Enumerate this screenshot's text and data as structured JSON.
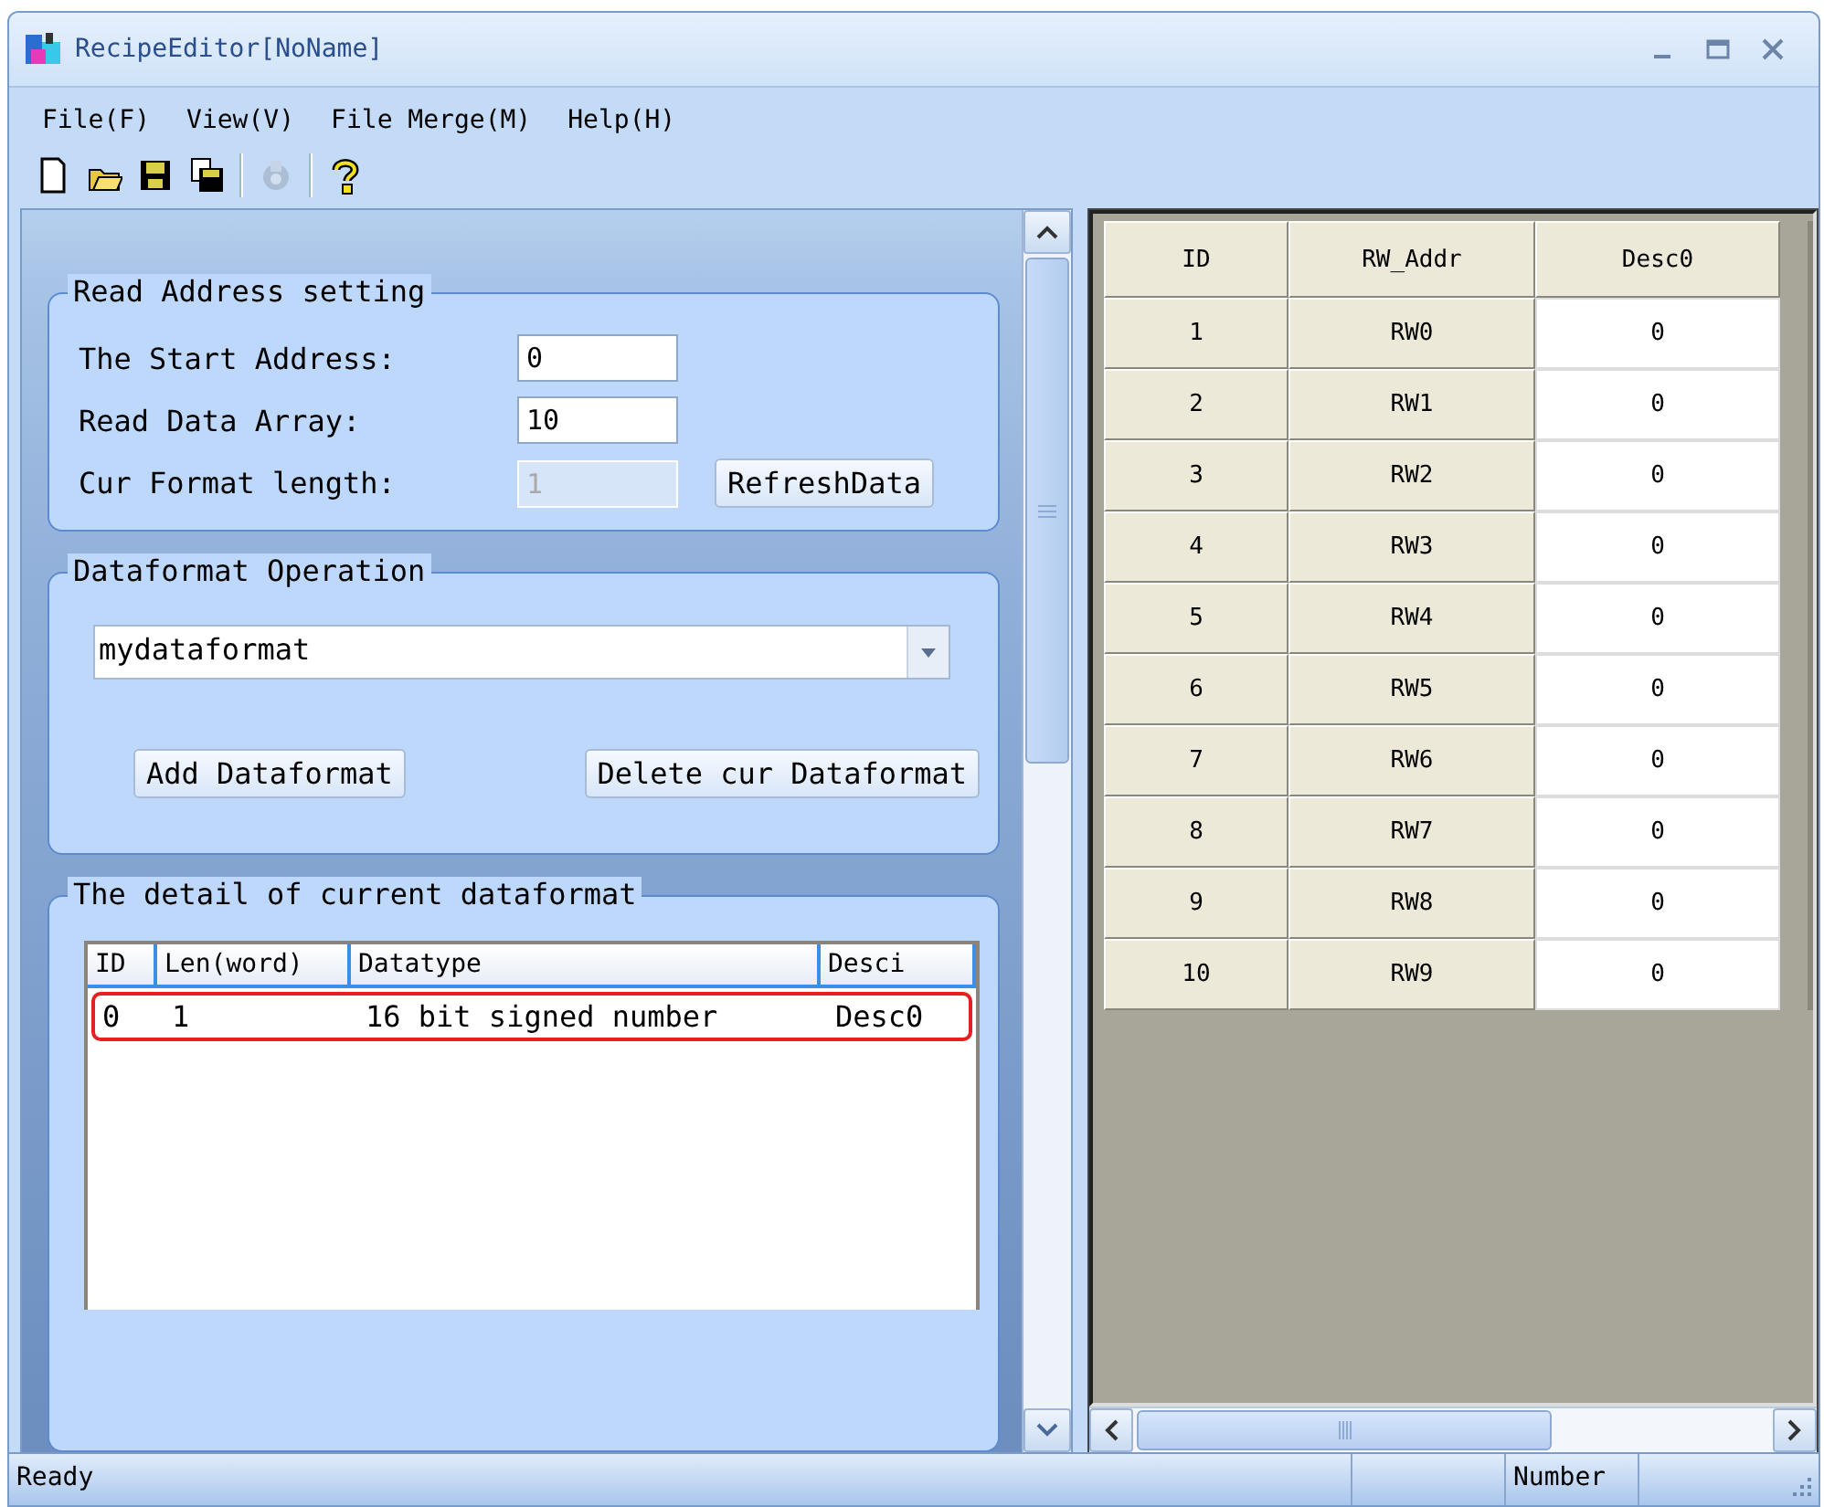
{
  "window": {
    "title": "RecipeEditor[NoName]"
  },
  "menu": [
    {
      "label": "File(F)"
    },
    {
      "label": "View(V)"
    },
    {
      "label": "File Merge(M)"
    },
    {
      "label": "Help(H)"
    }
  ],
  "toolbar": [
    {
      "kind": "new",
      "disabled": false
    },
    {
      "kind": "open",
      "disabled": false
    },
    {
      "kind": "save",
      "disabled": false
    },
    {
      "kind": "saveas",
      "disabled": false
    },
    {
      "kind": "sep"
    },
    {
      "kind": "print",
      "disabled": true
    },
    {
      "kind": "sep"
    },
    {
      "kind": "help",
      "disabled": false
    }
  ],
  "read_address": {
    "title": "Read Address setting",
    "fields": [
      {
        "label": "The Start Address:",
        "value": "0",
        "disabled": false
      },
      {
        "label": "Read Data Array:",
        "value": "10",
        "disabled": false
      },
      {
        "label": "Cur Format length:",
        "value": "1",
        "disabled": true
      }
    ],
    "button": "RefreshData"
  },
  "dataformat": {
    "title": "Dataformat Operation",
    "combo": "mydataformat",
    "buttons": [
      "Add Dataformat",
      "Delete cur Dataformat"
    ]
  },
  "detail": {
    "title": "The detail of current dataformat",
    "columns": [
      "ID",
      "Len(word)",
      "Datatype",
      "Desci"
    ],
    "rows": [
      {
        "cells": [
          "0",
          "1",
          "16 bit signed number",
          "Desc0"
        ],
        "selected": true
      }
    ]
  },
  "grid": {
    "columns": [
      "ID",
      "RW_Addr",
      "Desc0"
    ],
    "rows": [
      [
        "1",
        "RW0",
        "0"
      ],
      [
        "2",
        "RW1",
        "0"
      ],
      [
        "3",
        "RW2",
        "0"
      ],
      [
        "4",
        "RW3",
        "0"
      ],
      [
        "5",
        "RW4",
        "0"
      ],
      [
        "6",
        "RW5",
        "0"
      ],
      [
        "7",
        "RW6",
        "0"
      ],
      [
        "8",
        "RW7",
        "0"
      ],
      [
        "9",
        "RW8",
        "0"
      ],
      [
        "10",
        "RW9",
        "0"
      ]
    ]
  },
  "status_bar": {
    "message": "Ready",
    "indicator": "Number"
  }
}
